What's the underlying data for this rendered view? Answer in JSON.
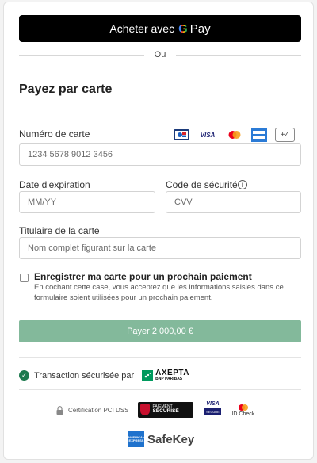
{
  "google_pay": {
    "label": "Acheter avec",
    "g": "G",
    "pay": "Pay"
  },
  "divider": {
    "text": "Ou"
  },
  "form": {
    "title": "Payez par carte",
    "card_number": {
      "label": "Numéro de carte",
      "placeholder": "1234 5678 9012 3456"
    },
    "card_logos": [
      "CB",
      "VISA",
      "Mastercard",
      "American Express"
    ],
    "more_brands": "+4",
    "expiry": {
      "label": "Date d'expiration",
      "placeholder": "MM/YY"
    },
    "cvv": {
      "label": "Code de sécurité",
      "placeholder": "CVV",
      "info_icon": "i"
    },
    "holder": {
      "label": "Titulaire de la carte",
      "placeholder": "Nom complet figurant sur la carte"
    },
    "save_card": {
      "label": "Enregistrer ma carte pour un prochain paiement",
      "description": "En cochant cette case, vous acceptez que les informations saisies dans ce formulaire soient utilisées pour un prochain paiement."
    },
    "pay_button": "Payer 2 000,00 €"
  },
  "security": {
    "text": "Transaction sécurisée par",
    "provider": "AXEPTA",
    "provider_sub": "BNP PARIBAS",
    "pci": "Certification PCI DSS",
    "paiement_securise_1": "PAIEMENT",
    "paiement_securise_2": "SÉCURISÉ",
    "visa_secure": "VISA",
    "visa_secure_sub": "SECURE",
    "id_check": "ID Check",
    "safekey": "SafeKey",
    "amex_small": "AMERICAN EXPRESS"
  },
  "colors": {
    "pay_button": "#83b99b",
    "gpay_bg": "#000000",
    "secure_check": "#1e7a4f"
  }
}
